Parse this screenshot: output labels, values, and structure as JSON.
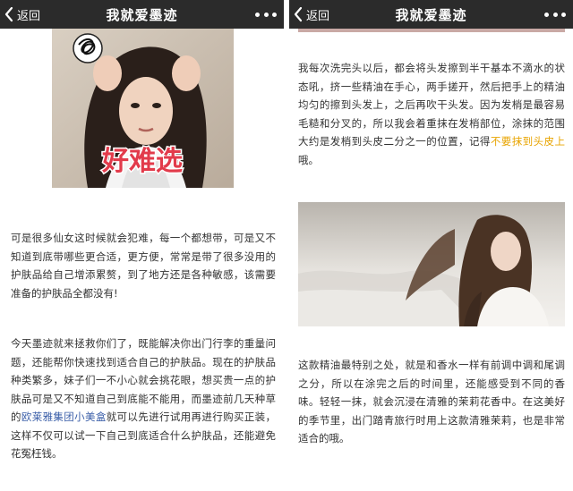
{
  "left": {
    "navbar": {
      "back_label": "返回",
      "title": "我就爱墨迹"
    },
    "image_caption": "好难选",
    "paragraph1": "可是很多仙女这时候就会犯难，每一个都想带，可是又不知道到底带哪些更合适，更方便，常常是带了很多没用的护肤品给自己增添累赘，到了地方还是各种敏感，该需要准备的护肤品全都没有!",
    "paragraph2": {
      "before": "今天墨迹就来拯救你们了，既能解决你出门行李的重量问题，还能帮你快速找到适合自己的护肤品。现在的护肤品种类繁多，妹子们一不小心就会挑花眼，想买贵一点的护肤品可是又不知道自己到底能不能用，而墨迹前几天种草的",
      "link": "欧莱雅集团小美盒",
      "after": "就可以先进行试用再进行购买正装，这样不仅可以试一下自己到底适合什么护肤品，还能避免花冤枉钱。"
    }
  },
  "right": {
    "navbar": {
      "back_label": "返回",
      "title": "我就爱墨迹"
    },
    "paragraph1": {
      "before": "我每次洗完头以后，都会将头发擦到半干基本不滴水的状态吼，挤一些精油在手心，两手搓开，然后把手上的精油均匀的擦到头发上，之后再吹干头发。因为发梢是最容易毛糙和分叉的，所以我会着重抹在发梢部位，涂抹的范围大约是发梢到头皮二分之一的位置，记得",
      "highlight": "不要抹到头皮上",
      "after": "哦。"
    },
    "paragraph2": "这款精油最特别之处，就是和香水一样有前调中调和尾调之分，所以在涂完之后的时间里，还能感受到不同的香味。轻轻一抹，就会沉浸在清雅的茉莉花香中。在这美好的季节里，出门踏青旅行时用上这款清雅茉莉，也是非常适合的哦。"
  },
  "colors": {
    "navbar": "#2b2b2b",
    "highlight": "#e8a400",
    "link": "#3a5ea8",
    "body_text": "#333333"
  },
  "icons": {
    "back": "chevron-left-icon",
    "more": "more-dots-icon"
  }
}
